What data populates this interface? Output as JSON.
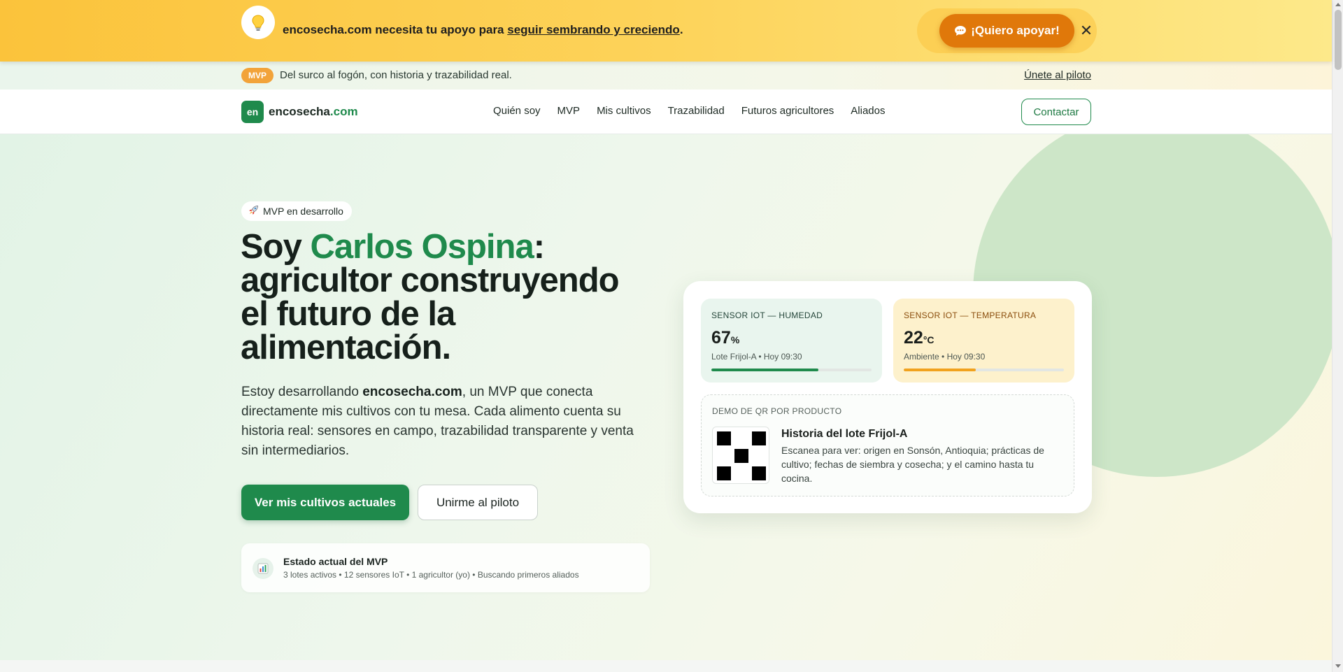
{
  "support_banner": {
    "icon": "lightbulb-icon",
    "text_prefix": "encosecha.com necesita tu apoyo para ",
    "text_link": "seguir sembrando y creciendo",
    "text_suffix": ".",
    "support_button_label": "¡Quiero apoyar!",
    "support_button_icon": "chat-bubble-icon",
    "close_label": "✕"
  },
  "announcement": {
    "badge": "MVP",
    "text": "Del surco al fogón, con historia y trazabilidad real.",
    "link": "Únete al piloto"
  },
  "nav": {
    "logo_mark": "en",
    "logo_name": "encosecha",
    "logo_tld": ".com",
    "links": [
      "Quién soy",
      "MVP",
      "Mis cultivos",
      "Trazabilidad",
      "Futuros agricultores",
      "Aliados"
    ],
    "contact_label": "Contactar"
  },
  "hero": {
    "badge_icon": "rocket-icon",
    "badge_text": "MVP en desarrollo",
    "title_prefix": "Soy ",
    "title_name": "Carlos Ospina",
    "title_suffix": ": agricultor construyendo el futuro de la alimentación.",
    "desc_prefix": "Estoy desarrollando ",
    "desc_brand": "encosecha.com",
    "desc_suffix": ", un MVP que conecta directamente mis cultivos con tu mesa. Cada alimento cuenta su historia real: sensores en campo, trazabilidad transparente y venta sin intermediarios.",
    "primary_button": "Ver mis cultivos actuales",
    "secondary_button": "Unirme al piloto",
    "status": {
      "icon": "bar-chart-icon",
      "title": "Estado actual del MVP",
      "subtitle": "3 lotes activos • 12 sensores IoT • 1 agricultor (yo) • Buscando primeros aliados"
    }
  },
  "dashboard": {
    "humidity": {
      "label": "SENSOR IOT — HUMEDAD",
      "value": "67",
      "unit": "%",
      "meta": "Lote Frijol-A • Hoy 09:30",
      "level": 0.67,
      "color": "#1f8a4c"
    },
    "temperature": {
      "label": "SENSOR IOT — TEMPERATURA",
      "value": "22",
      "unit": "°C",
      "meta": "Ambiente • Hoy 09:30",
      "level": 0.45,
      "color": "#f1a21e"
    },
    "qr": {
      "label": "DEMO DE QR POR PRODUCTO",
      "title": "Historia del lote Frijol-A",
      "description": "Escanea para ver: origen en Sonsón, Antioquia; prácticas de cultivo; fechas de siembra y cosecha; y el camino hasta tu cocina."
    }
  },
  "colors": {
    "brand_green": "#1f8a4c",
    "banner_yellow": "#fbc33b",
    "support_orange": "#e0780a"
  }
}
